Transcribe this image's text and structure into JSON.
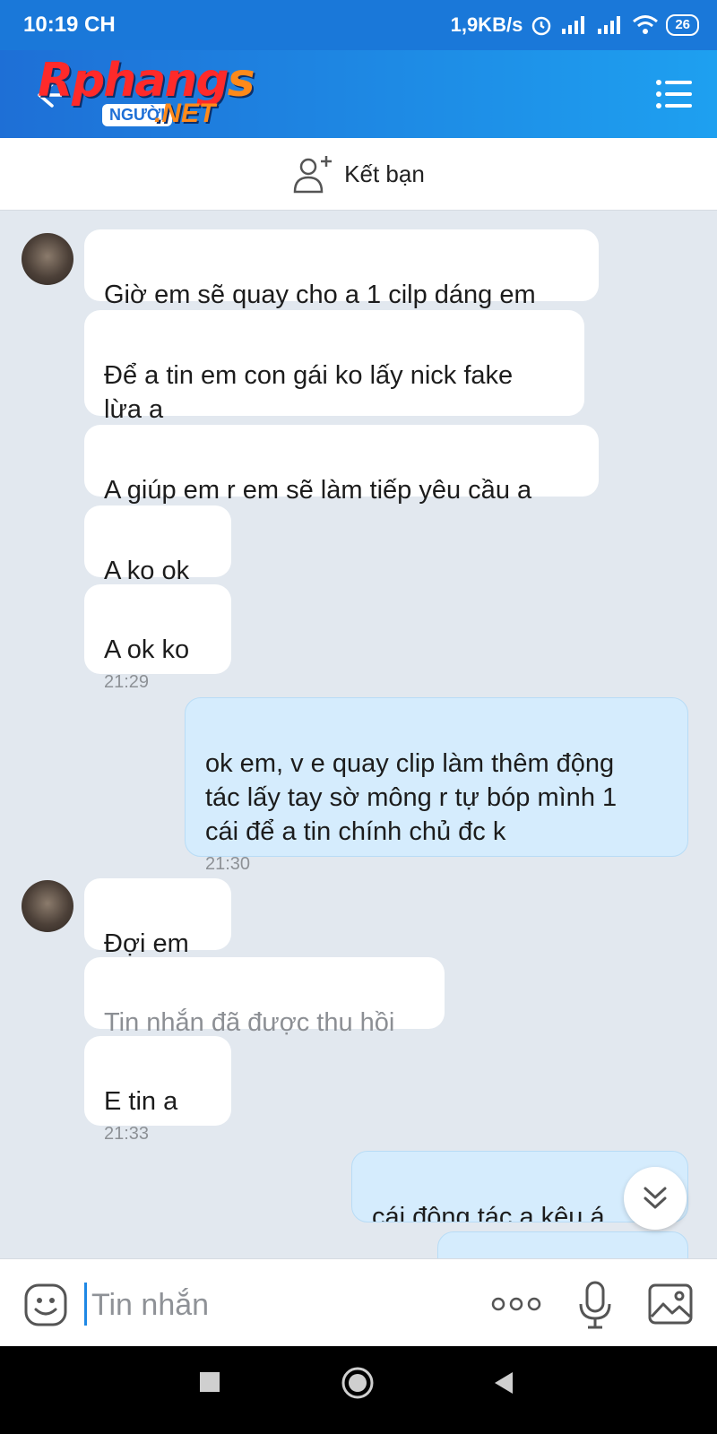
{
  "status_bar": {
    "time": "10:19 CH",
    "network_speed": "1,9KB/s",
    "battery": "26"
  },
  "header": {
    "logo_main": "Rphangs",
    "logo_sub": "NGƯỜI",
    "logo_net": ".NET"
  },
  "friend_bar": {
    "label": "Kết bạn"
  },
  "messages": [
    {
      "side": "them",
      "text": "Giờ em sẽ quay cho a 1 cilp dáng em"
    },
    {
      "side": "them",
      "text": "Để a tin em con gái ko lấy nick fake\nlừa a"
    },
    {
      "side": "them",
      "text": "A giúp em r em sẽ làm tiếp yêu cầu a"
    },
    {
      "side": "them",
      "text": "A ko ok"
    },
    {
      "side": "them",
      "text": "A ok ko",
      "time": "21:29"
    },
    {
      "side": "me",
      "text": "ok em, v e quay clip làm thêm động\ntác lấy tay sờ mông r tự bóp mình 1\ncái để a tin chính chủ đc k",
      "time": "21:30"
    },
    {
      "side": "them",
      "text": "Đợi em"
    },
    {
      "side": "them",
      "text": "Tin nhắn đã được thu hồi",
      "recalled": true
    },
    {
      "side": "them",
      "text": "E tin a",
      "time": "21:33"
    },
    {
      "side": "me",
      "text": "cái động tác a kêu á"
    },
    {
      "side": "me",
      "text": ""
    }
  ],
  "input_bar": {
    "placeholder": "Tin nhắn"
  },
  "icons": {
    "back": "back-arrow-icon",
    "menu": "hamburger-menu-icon",
    "add_friend": "add-friend-icon",
    "scroll_down": "double-chevron-down-icon",
    "emoji": "emoji-icon",
    "more": "more-dots-icon",
    "mic": "microphone-icon",
    "gallery": "gallery-icon"
  },
  "colors": {
    "header_start": "#1e6fd6",
    "header_end": "#1ea0f0",
    "chat_background": "#e2e8ef",
    "my_bubble": "#d5ecfd",
    "their_bubble": "#ffffff",
    "accent": "#1e88e5"
  }
}
